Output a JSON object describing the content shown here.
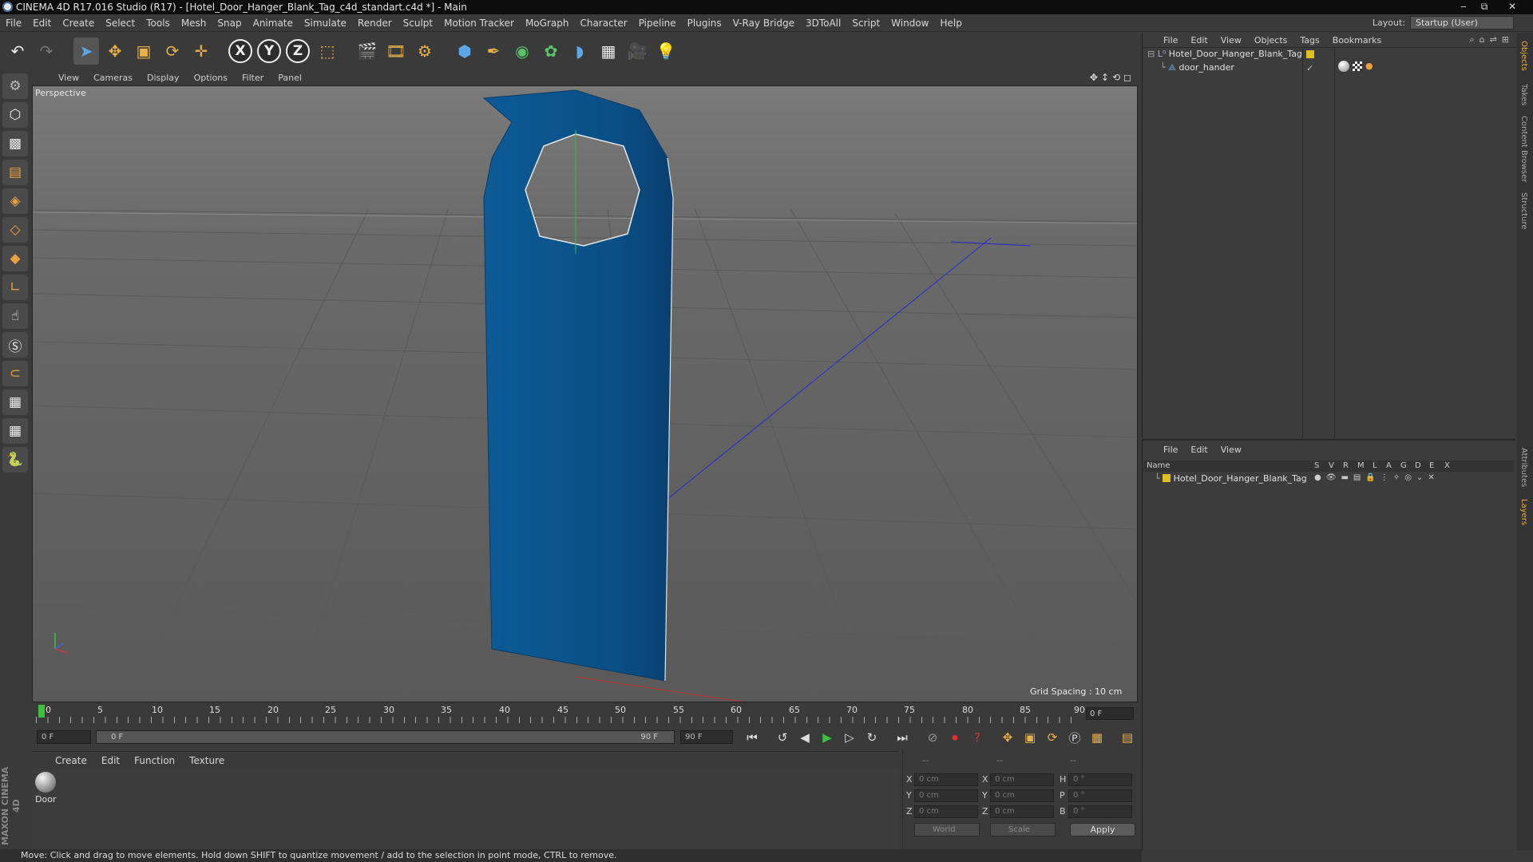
{
  "window": {
    "title": "CINEMA 4D R17.016 Studio (R17) - [Hotel_Door_Hanger_Blank_Tag_c4d_standart.c4d *] - Main",
    "buttons": [
      "‒",
      "⧉",
      "✕"
    ]
  },
  "menubar": {
    "items": [
      "File",
      "Edit",
      "Create",
      "Select",
      "Tools",
      "Mesh",
      "Snap",
      "Animate",
      "Simulate",
      "Render",
      "Sculpt",
      "Motion Tracker",
      "MoGraph",
      "Character",
      "Pipeline",
      "Plugins",
      "V-Ray Bridge",
      "3DToAll",
      "Script",
      "Window",
      "Help"
    ],
    "layout_label": "Layout:",
    "layout_value": "Startup (User)"
  },
  "toolbar": {
    "axis_x": "X",
    "axis_y": "Y",
    "axis_z": "Z"
  },
  "viewport": {
    "menu": [
      "View",
      "Cameras",
      "Display",
      "Options",
      "Filter",
      "Panel"
    ],
    "label": "Perspective",
    "grid_spacing": "Grid Spacing : 10 cm",
    "object_color": "#0a5a9a",
    "axis_labels": [
      "y",
      "z",
      "x"
    ]
  },
  "timeline": {
    "ticks": [
      "0",
      "5",
      "10",
      "15",
      "20",
      "25",
      "30",
      "35",
      "40",
      "45",
      "50",
      "55",
      "60",
      "65",
      "70",
      "75",
      "80",
      "85",
      "90"
    ],
    "current_frame": "0 F",
    "start_field": "0 F",
    "range_start": "0 F",
    "range_end": "90 F",
    "end_field": "90 F"
  },
  "material_manager": {
    "menu": [
      "Create",
      "Edit",
      "Function",
      "Texture"
    ],
    "materials": [
      {
        "name": "Door"
      }
    ]
  },
  "coordinates": {
    "headers": [
      "--",
      "--",
      "--"
    ],
    "rows": [
      {
        "axis": "X",
        "pos": "0 cm",
        "size_axis": "X",
        "size": "0 cm",
        "rot_axis": "H",
        "rot": "0 °"
      },
      {
        "axis": "Y",
        "pos": "0 cm",
        "size_axis": "Y",
        "size": "0 cm",
        "rot_axis": "P",
        "rot": "0 °"
      },
      {
        "axis": "Z",
        "pos": "0 cm",
        "size_axis": "Z",
        "size": "0 cm",
        "rot_axis": "B",
        "rot": "0 °"
      }
    ],
    "space": "World",
    "mode": "Scale",
    "apply": "Apply"
  },
  "status": "Move: Click and drag to move elements. Hold down SHIFT to quantize movement / add to the selection in point mode, CTRL to remove.",
  "object_manager": {
    "menu": [
      "File",
      "Edit",
      "View",
      "Objects",
      "Tags",
      "Bookmarks"
    ],
    "objects": [
      {
        "name": "Hotel_Door_Hanger_Blank_Tag"
      },
      {
        "name": "door_hander"
      }
    ]
  },
  "layer_manager": {
    "menu": [
      "File",
      "Edit",
      "View"
    ],
    "columns": [
      "Name",
      "S",
      "V",
      "R",
      "M",
      "L",
      "A",
      "G",
      "D",
      "E",
      "X"
    ],
    "layers": [
      {
        "name": "Hotel_Door_Hanger_Blank_Tag",
        "color": "#e0c020"
      }
    ]
  },
  "side_tabs": [
    "Objects",
    "Takes",
    "Content Browser",
    "Structure",
    "Attributes",
    "Layers"
  ],
  "brand": "MAXON CINEMA 4D"
}
